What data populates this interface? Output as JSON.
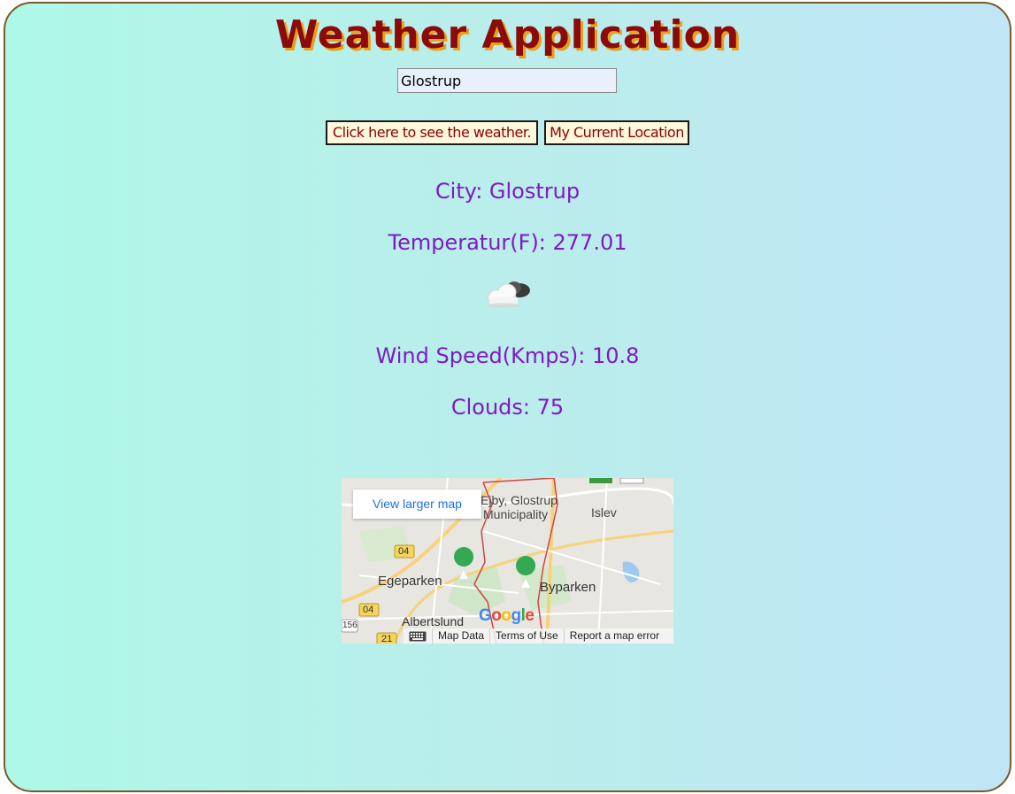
{
  "header": {
    "title": "Weather Application"
  },
  "search": {
    "value": "Glostrup"
  },
  "buttons": {
    "weather": "Click here to see the weather.",
    "location": "My Current Location"
  },
  "weather": {
    "city": "City: Glostrup",
    "temperature": "Temperatur(F): 277.01",
    "icon": "cloud-icon",
    "wind": "Wind Speed(Kmps): 10.8",
    "clouds": "Clouds: 75"
  },
  "map": {
    "view_larger": "View larger map",
    "labels": {
      "ejby": "Ejby, Glostrup",
      "municipality": "Municipality",
      "islev": "Islev",
      "egeparken": "Egeparken",
      "byparken": "Byparken",
      "albertslund": "Albertslund",
      "road_04_top": "04",
      "road_04_bottom": "04",
      "road_21": "21",
      "road_156": "156"
    },
    "google_logo": "Google",
    "footer": {
      "keyboard_icon": "keyboard-icon",
      "map_data": "Map Data",
      "terms": "Terms of Use",
      "report": "Report a map error"
    }
  }
}
